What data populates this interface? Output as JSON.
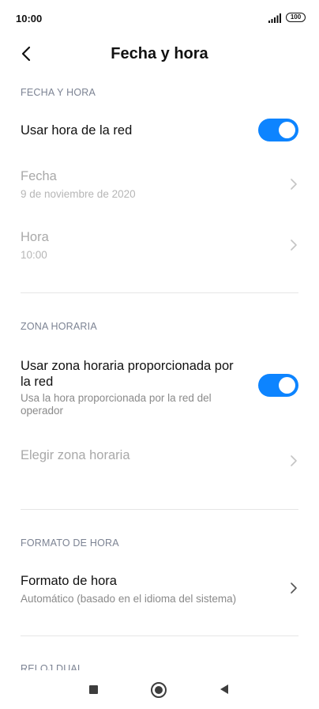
{
  "status_bar": {
    "time": "10:00",
    "battery": "100",
    "signal_icon": "signal-bars-icon"
  },
  "header": {
    "title": "Fecha y hora",
    "back_icon": "chevron-left-icon"
  },
  "sections": {
    "date_time": {
      "header": "FECHA Y HORA",
      "network_time": {
        "label": "Usar hora de la red",
        "enabled": true
      },
      "date": {
        "label": "Fecha",
        "value": "9 de noviembre de 2020",
        "disabled": true
      },
      "time": {
        "label": "Hora",
        "value": "10:00",
        "disabled": true
      }
    },
    "time_zone": {
      "header": "ZONA HORARIA",
      "network_zone": {
        "label_line1": "Usar zona horaria proporcionada por",
        "label_line2": "la red",
        "desc_line1": "Usa la hora proporcionada por la red del",
        "desc_line2": "operador",
        "enabled": true
      },
      "choose_zone": {
        "label": "Elegir zona horaria",
        "disabled": true
      }
    },
    "time_format": {
      "header": "FORMATO DE HORA",
      "format": {
        "label": "Formato de hora",
        "value": "Automático (basado en el idioma del sistema)"
      }
    },
    "dual_clock": {
      "header": "RELOJ DUAL"
    }
  },
  "colors": {
    "accent": "#0d84ff",
    "section_header": "#7c8393",
    "disabled": "#a9a9a9"
  },
  "nav": {
    "recents_icon": "square-icon",
    "home_icon": "circle-home-icon",
    "back_icon": "triangle-back-icon"
  }
}
